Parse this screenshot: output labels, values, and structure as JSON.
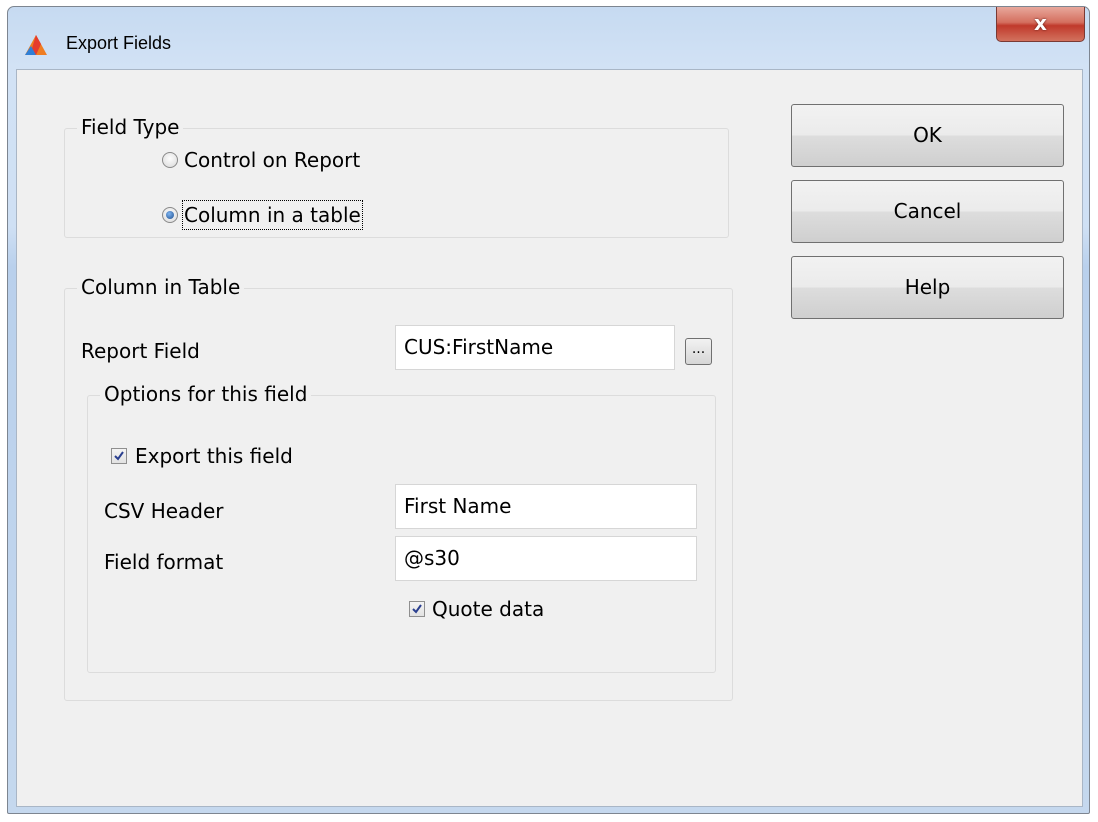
{
  "window": {
    "title": "Export Fields",
    "close_glyph": "x",
    "app_icon": "app-logo-icon"
  },
  "field_type": {
    "group_label": "Field Type",
    "options": [
      {
        "label": "Control on Report",
        "checked": false
      },
      {
        "label": "Column in a table",
        "checked": true
      }
    ]
  },
  "column_in_table": {
    "group_label": "Column in Table",
    "report_field_label": "Report Field",
    "report_field_value": "CUS:FirstName",
    "lookup_button": "...",
    "options": {
      "group_label": "Options for this field",
      "export_label": "Export this field",
      "export_checked": true,
      "csv_header_label": "CSV Header",
      "csv_header_value": "First Name",
      "field_format_label": "Field format",
      "field_format_value": "@s30",
      "quote_label": "Quote data",
      "quote_checked": true
    }
  },
  "buttons": {
    "ok": "OK",
    "cancel": "Cancel",
    "help": "Help"
  }
}
